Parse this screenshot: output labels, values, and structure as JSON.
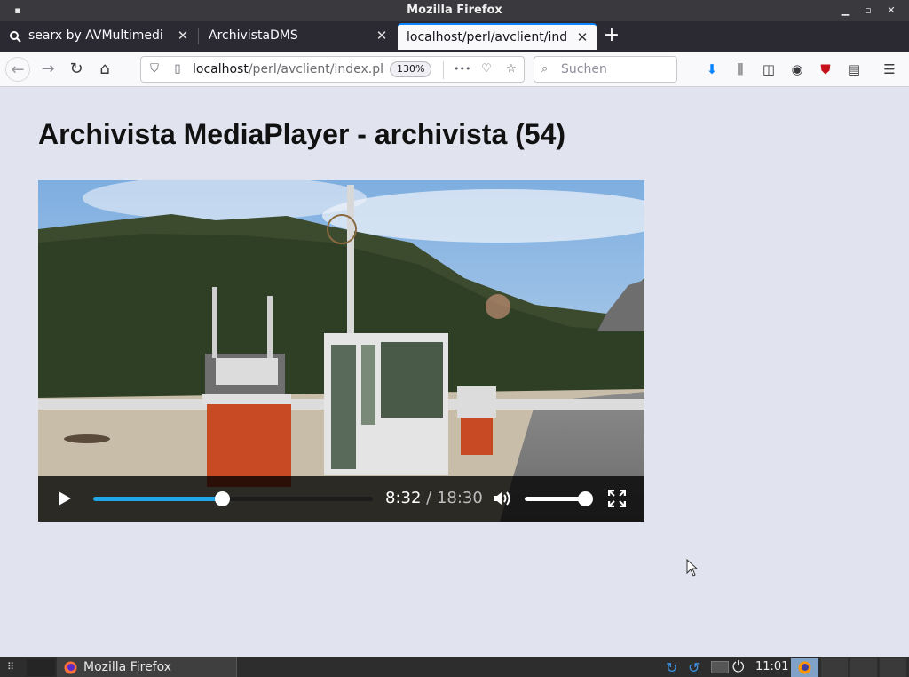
{
  "window": {
    "title": "Mozilla Firefox"
  },
  "tabs": [
    {
      "label": "searx by AVMultimedia",
      "close": "✕",
      "active": false
    },
    {
      "label": "ArchivistaDMS",
      "close": "✕",
      "active": false
    },
    {
      "label": "localhost/perl/avclient/index",
      "close": "✕",
      "active": true
    }
  ],
  "newtab_label": "+",
  "navbar": {
    "url_host": "localhost",
    "url_path": "/perl/avclient/index.pl",
    "zoom": "130%",
    "search_placeholder": "Suchen",
    "more_label": "•••"
  },
  "page": {
    "title": "Archivista MediaPlayer - archivista (54)"
  },
  "player": {
    "current_time": "8:32",
    "separator": " / ",
    "duration": "18:30",
    "progress_fraction": 0.461,
    "volume_fraction": 1.0,
    "accent_color": "#1fa7e8"
  },
  "taskbar": {
    "task_label": "Mozilla Firefox",
    "clock": "11:01"
  }
}
